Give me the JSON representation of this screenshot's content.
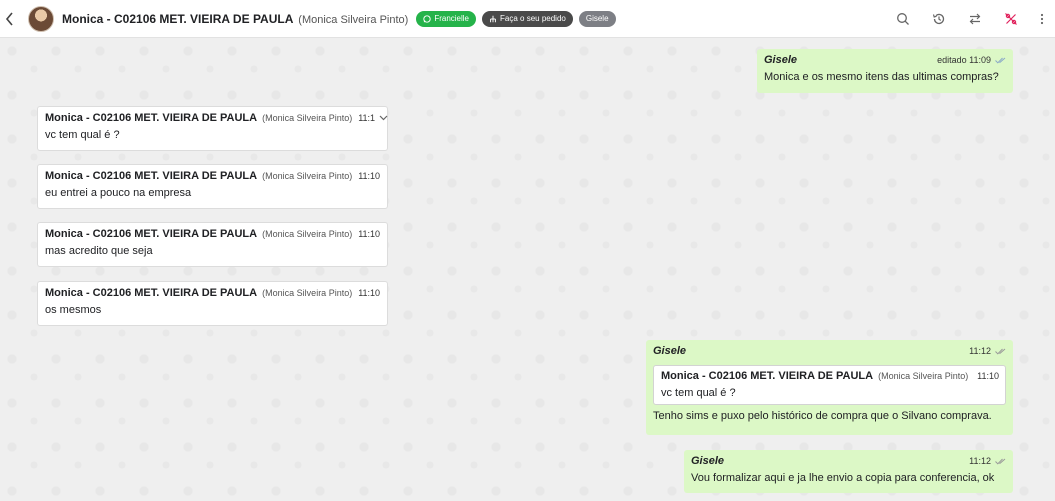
{
  "header": {
    "contact_title": "Monica - C02106 MET. VIEIRA DE PAULA",
    "contact_subtitle": "(Monica Silveira Pinto)",
    "badges": [
      {
        "label": "Francielle",
        "color": "#25b34a",
        "icon": "whatsapp-icon"
      },
      {
        "label": "Faça o seu pedido",
        "color": "#4a4a4a",
        "icon": "tree-icon"
      },
      {
        "label": "Gisele",
        "color": "#7d7f85"
      }
    ],
    "actions": [
      "search-icon",
      "history-icon",
      "transfer-icon",
      "percent-off-icon",
      "more-icon"
    ]
  },
  "messages": [
    {
      "direction": "out",
      "sender": "Gisele",
      "meta": "editado 11:09",
      "text": "Monica e os mesmo itens das ultimas compras?"
    },
    {
      "direction": "in",
      "sender": "Monica - C02106 MET. VIEIRA DE PAULA",
      "sender_sub": "(Monica Silveira Pinto)",
      "time": "11:1",
      "text": "vc tem qual é ?"
    },
    {
      "direction": "in",
      "sender": "Monica - C02106 MET. VIEIRA DE PAULA",
      "sender_sub": "(Monica Silveira Pinto)",
      "time": "11:10",
      "text": "eu entrei a pouco na empresa"
    },
    {
      "direction": "in",
      "sender": "Monica - C02106 MET. VIEIRA DE PAULA",
      "sender_sub": "(Monica Silveira Pinto)",
      "time": "11:10",
      "text": "mas acredito que seja"
    },
    {
      "direction": "in",
      "sender": "Monica - C02106 MET. VIEIRA DE PAULA",
      "sender_sub": "(Monica Silveira Pinto)",
      "time": "11:10",
      "text": "os mesmos"
    },
    {
      "direction": "out",
      "sender": "Gisele",
      "time": "11:12",
      "quote": {
        "sender": "Monica - C02106 MET. VIEIRA DE PAULA",
        "sender_sub": "(Monica Silveira Pinto)",
        "time": "11:10",
        "text": "vc tem qual é ?"
      },
      "text": "Tenho sims e puxo pelo histórico de compra que o Silvano comprava."
    },
    {
      "direction": "out",
      "sender": "Gisele",
      "time": "11:12",
      "text": "Vou formalizar aqui e ja lhe envio a copia para conferencia, ok"
    }
  ],
  "colors": {
    "incoming_bubble": "#ffffff",
    "outgoing_bubble": "#dcf8c6",
    "tick": "#8aa9c8"
  }
}
